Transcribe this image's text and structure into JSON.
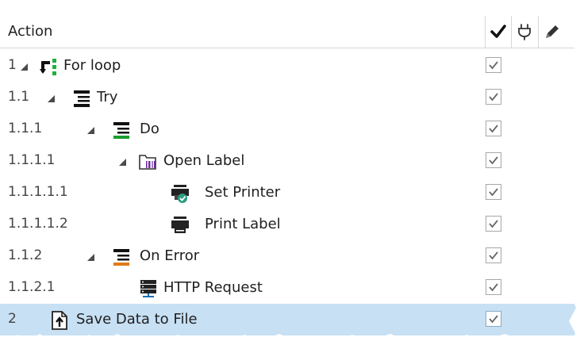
{
  "header": {
    "action_label": "Action",
    "enabled_icon": "checkmark-icon",
    "breakpoint_icon": "plug-icon",
    "edit_icon": "pencil-icon"
  },
  "rows": [
    {
      "num": "1",
      "label": "For loop",
      "icon": "loop-icon",
      "expander": true
    },
    {
      "num": "1.1",
      "label": "Try",
      "icon": "try-icon",
      "expander": true
    },
    {
      "num": "1.1.1",
      "label": "Do",
      "icon": "do-icon",
      "expander": true
    },
    {
      "num": "1.1.1.1",
      "label": "Open Label",
      "icon": "open-label-icon",
      "expander": true
    },
    {
      "num": "1.1.1.1.1",
      "label": "Set Printer",
      "icon": "set-printer-icon",
      "expander": false
    },
    {
      "num": "1.1.1.1.2",
      "label": "Print Label",
      "icon": "printer-icon",
      "expander": false
    },
    {
      "num": "1.1.2",
      "label": "On Error",
      "icon": "on-error-icon",
      "expander": true
    },
    {
      "num": "1.1.2.1",
      "label": "HTTP Request",
      "icon": "http-request-icon",
      "expander": false
    },
    {
      "num": "2",
      "label": "Save Data to File",
      "icon": "save-file-icon",
      "expander": false,
      "selected": true
    }
  ],
  "colors": {
    "selected_row": "#c7e0f4",
    "loop_green": "#1db33a",
    "do_green": "#1a9e2f",
    "error_orange": "#e07b16",
    "label_purple": "#6b2fa3",
    "check_teal": "#2e9c7f"
  }
}
